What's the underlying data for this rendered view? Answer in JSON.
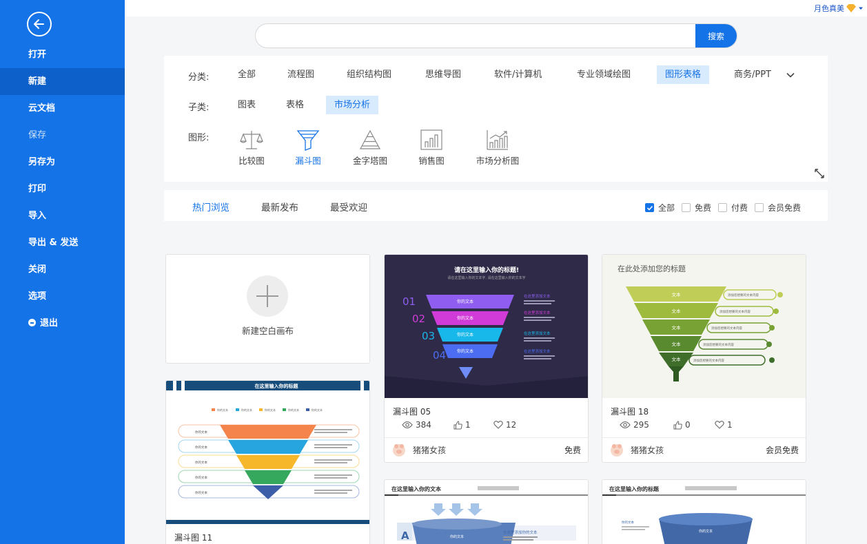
{
  "sidebar": {
    "items": [
      {
        "label": "打开"
      },
      {
        "label": "新建"
      },
      {
        "label": "云文档"
      },
      {
        "label": "保存"
      },
      {
        "label": "另存为"
      },
      {
        "label": "打印"
      },
      {
        "label": "导入"
      },
      {
        "label": "导出 & 发送"
      },
      {
        "label": "关闭"
      },
      {
        "label": "选项"
      },
      {
        "label": "退出"
      }
    ],
    "active": "新建"
  },
  "header": {
    "user_name": "月色真美"
  },
  "search": {
    "placeholder": "",
    "button_label": "搜索"
  },
  "filters": {
    "category_label": "分类:",
    "categories": [
      "全部",
      "流程图",
      "组织结构图",
      "思维导图",
      "软件/计算机",
      "专业领域绘图",
      "图形表格",
      "商务/PPT"
    ],
    "selected_category": "图形表格",
    "subcategory_label": "子类:",
    "subcategories": [
      "图表",
      "表格",
      "市场分析"
    ],
    "selected_subcategory": "市场分析",
    "shape_label": "图形:",
    "shapes": [
      {
        "label": "比较图",
        "icon": "balance-scale-icon"
      },
      {
        "label": "漏斗图",
        "icon": "funnel-icon"
      },
      {
        "label": "金字塔图",
        "icon": "pyramid-icon"
      },
      {
        "label": "销售图",
        "icon": "bar-chart-icon"
      },
      {
        "label": "市场分析图",
        "icon": "growth-chart-icon"
      }
    ],
    "selected_shape": "漏斗图"
  },
  "sort": {
    "tabs": [
      "热门浏览",
      "最新发布",
      "最受欢迎"
    ],
    "selected": "热门浏览",
    "checkboxes": [
      {
        "label": "全部",
        "checked": true
      },
      {
        "label": "免费",
        "checked": false
      },
      {
        "label": "付费",
        "checked": false
      },
      {
        "label": "会员免费",
        "checked": false
      }
    ]
  },
  "blank_canvas": {
    "label": "新建空白画布"
  },
  "templates": [
    {
      "title": "漏斗图 05",
      "views": "384",
      "likes": "1",
      "favorites": "12",
      "author": "猪猪女孩",
      "price": "免费",
      "thumb_text": {
        "title": "请在这里输入你的标题!",
        "subtitle": "请在这里输入你的文本字,  请在这里输入你的文本字",
        "nums": [
          "01",
          "02",
          "03",
          "04"
        ],
        "stage": "你的文本",
        "note": "在这里添加文本"
      }
    },
    {
      "title": "漏斗图 18",
      "views": "295",
      "likes": "0",
      "favorites": "1",
      "author": "猪猪女孩",
      "price": "会员免费",
      "thumb_text": {
        "title": "在此处添加您的标题",
        "stage": "文本",
        "note": "添加您想要的文本内容"
      }
    },
    {
      "title": "漏斗图 11",
      "thumb_text": {
        "title": "在这里输入你的标题",
        "legend": "你的文本",
        "pill": "你的文本"
      }
    },
    {
      "thumb_text": {
        "title": "在这里输入你的文本",
        "letter": "A",
        "stage": "你的文本",
        "note": "在这里添加你的文本"
      }
    },
    {
      "thumb_text": {
        "title": "在这里输入你的标题",
        "side": "你的文本",
        "stage": "你的文本"
      }
    }
  ],
  "colors": {
    "sidebar": "#1573e8",
    "active": "#0d5fc9",
    "accent": "#1573e8",
    "chip_selected_bg": "#d8eafd"
  }
}
